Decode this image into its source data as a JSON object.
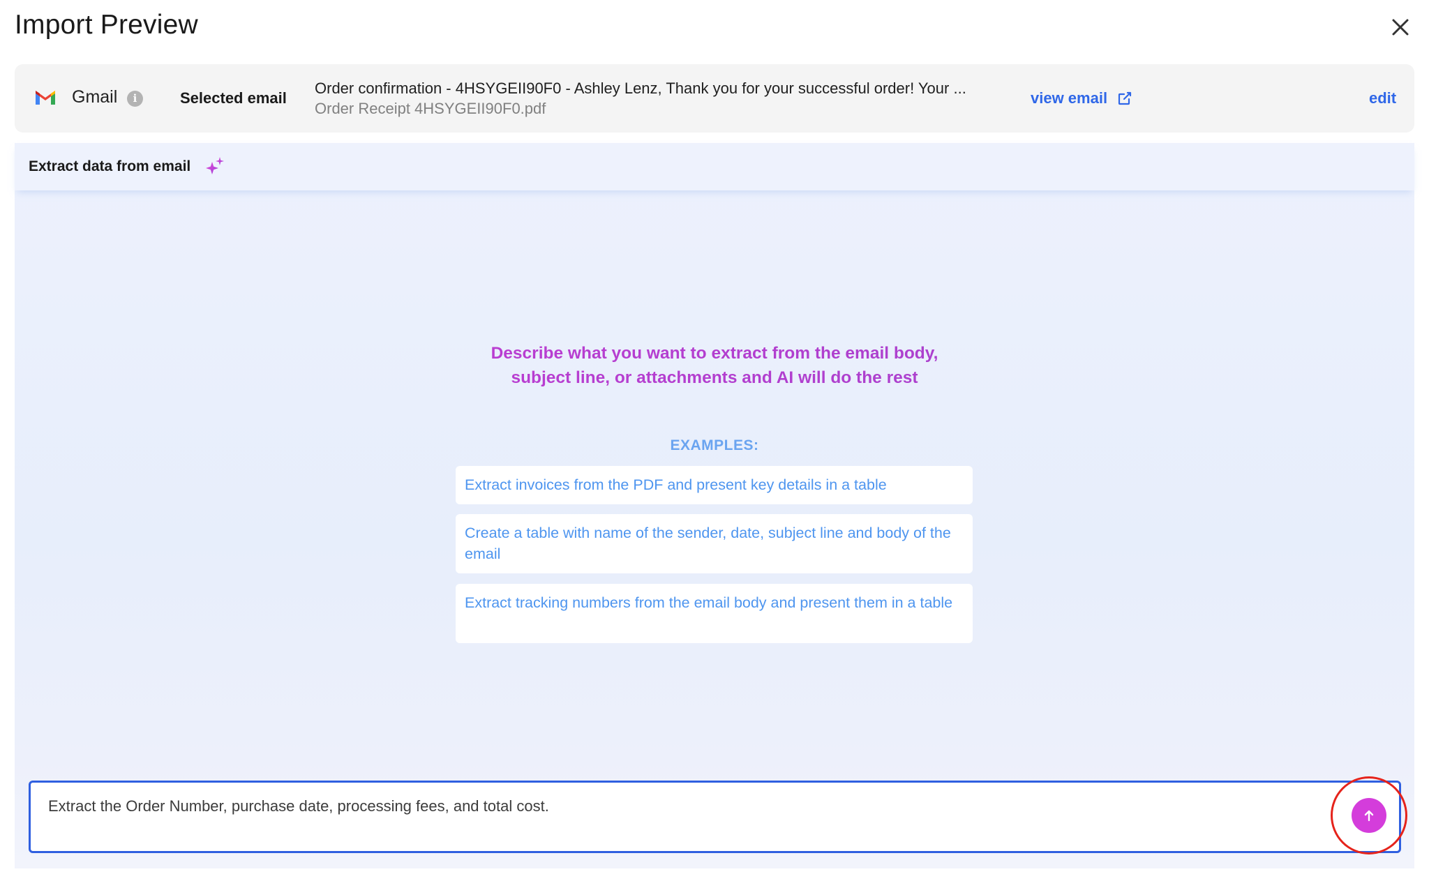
{
  "dialog": {
    "title": "Import Preview"
  },
  "source": {
    "service_label": "Gmail",
    "selected_label": "Selected email",
    "email_subject": "Order confirmation - 4HSYGEII90F0 - Ashley Lenz, Thank you for your successful order! Your ...",
    "email_attachment": "Order Receipt 4HSYGEII90F0.pdf",
    "view_email_label": "view email",
    "edit_label": "edit"
  },
  "extract": {
    "header_title": "Extract data from email",
    "hint_line1": "Describe what you want to extract from the email body,",
    "hint_line2": "subject line, or attachments and AI will do the rest",
    "examples_label": "EXAMPLES:",
    "examples": [
      "Extract invoices from the PDF and present key details in a table",
      "Create a table with name of the sender, date, subject line and body of the email",
      "Extract tracking numbers from the email body and present them in a table"
    ],
    "prompt_value": "Extract the Order Number, purchase date, processing fees, and total cost."
  },
  "colors": {
    "accent_blue": "#2f67e8",
    "example_blue": "#4e95ef",
    "send_magenta": "#d43ddb",
    "highlight_red": "#e5231b"
  },
  "icons": {
    "close": "close-icon",
    "gmail": "gmail-icon",
    "info": "info-icon",
    "external_link": "external-link-icon",
    "sparkle": "sparkle-icon",
    "send": "arrow-up-icon"
  }
}
